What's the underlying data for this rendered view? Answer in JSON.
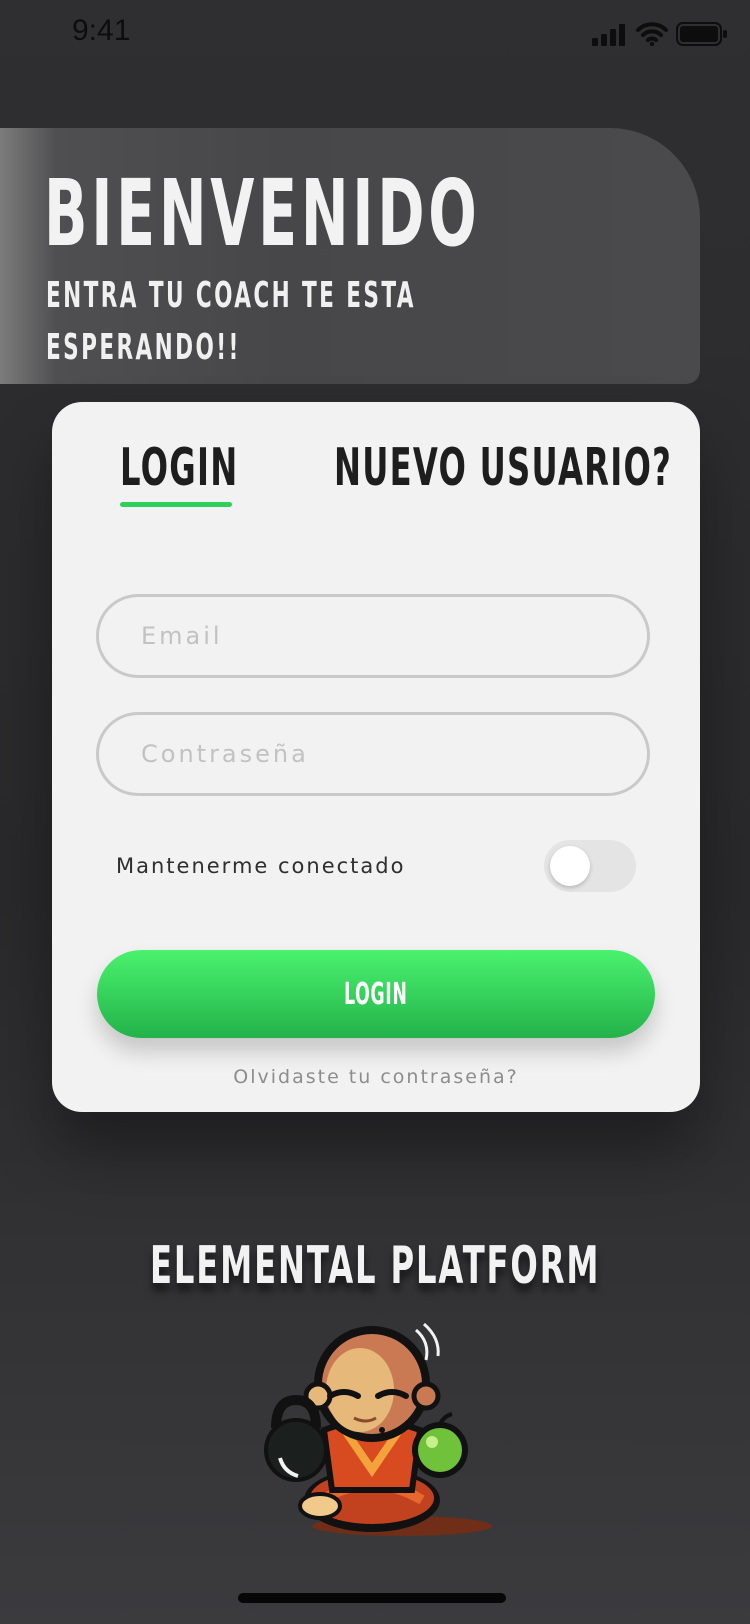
{
  "status_bar": {
    "time": "9:41"
  },
  "welcome": {
    "title": "BIENVENIDO",
    "subtitle": "ENTRA TU COACH TE ESTA ESPERANDO!!"
  },
  "tabs": [
    {
      "label": "LOGIN",
      "active": true
    },
    {
      "label": "NUEVO USUARIO?",
      "active": false
    }
  ],
  "form": {
    "email_placeholder": "Email",
    "email_value": "",
    "password_placeholder": "Contraseña",
    "password_value": "",
    "remember_label": "Mantenerme conectado",
    "remember_on": false,
    "login_button": "LOGIN",
    "forgot_link": "Olvidaste tu contraseña?"
  },
  "footer": {
    "platform_name": "ELEMENTAL PLATFORM"
  },
  "colors": {
    "accent": "#2ecf5a",
    "button_top": "#4af26e",
    "button_bottom": "#23b24a",
    "background": "#2b2b2d",
    "card": "#f2f2f2"
  },
  "icons": [
    "signal-icon",
    "wifi-icon",
    "battery-icon",
    "monk-mascot-logo"
  ]
}
